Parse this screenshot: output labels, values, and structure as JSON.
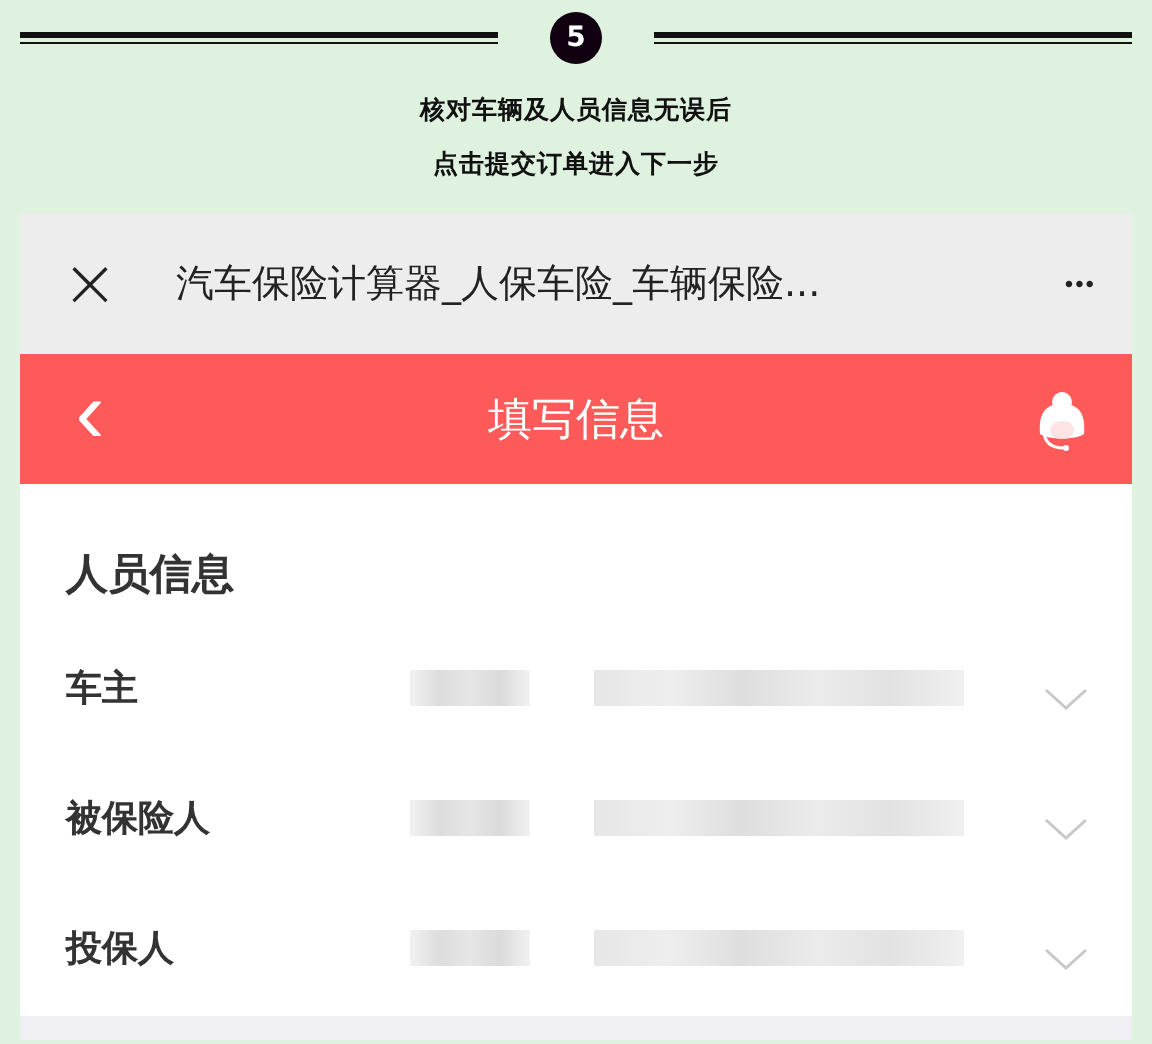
{
  "step": {
    "number": "5",
    "lines": [
      "核对车辆及人员信息无误后",
      "点击提交订单进入下一步"
    ]
  },
  "browser_bar": {
    "close": "×",
    "title": "汽车保险计算器_人保车险_车辆保险...",
    "more": "•••"
  },
  "header": {
    "back": "‹",
    "title": "填写信息"
  },
  "section": {
    "title": "人员信息",
    "rows": [
      {
        "label": "车主"
      },
      {
        "label": "被保险人"
      },
      {
        "label": "投保人"
      }
    ]
  }
}
